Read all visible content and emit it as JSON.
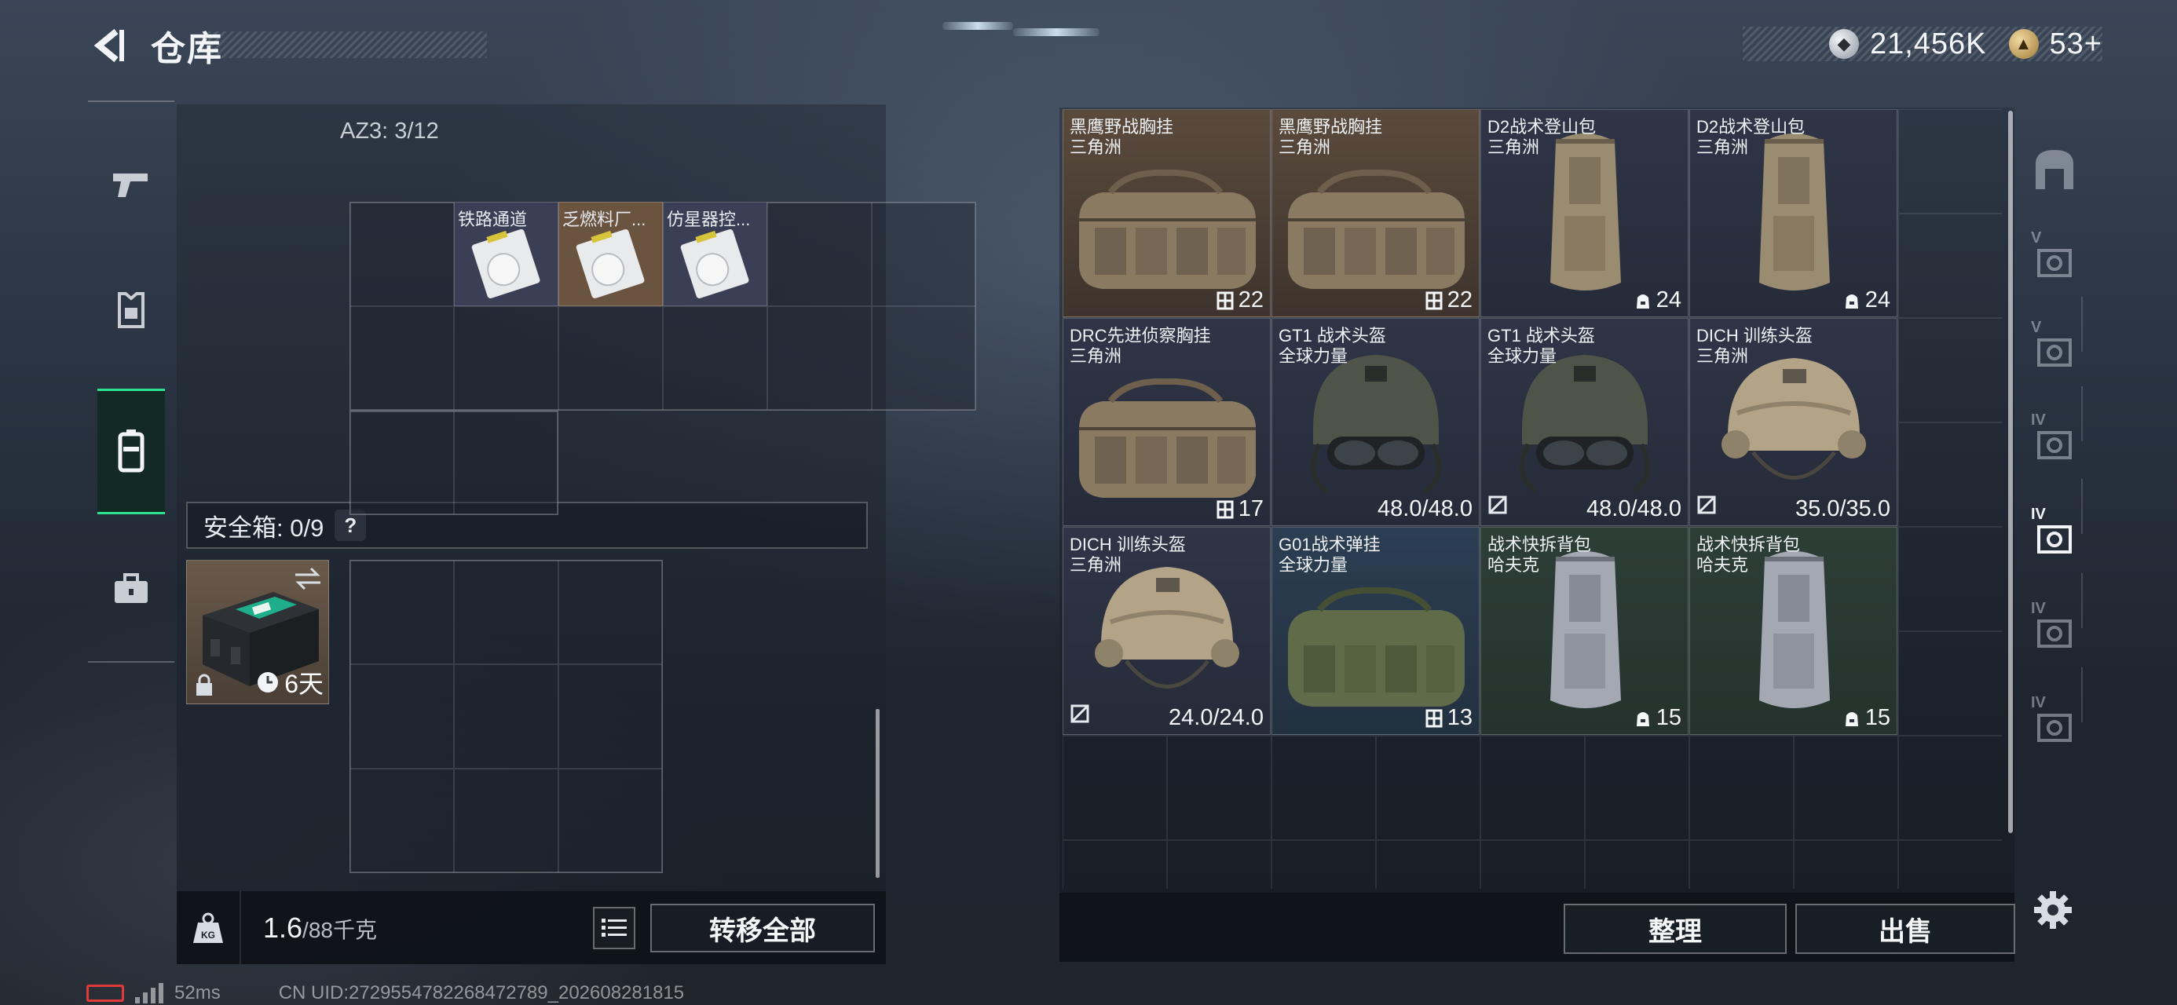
{
  "header": {
    "title": "仓库",
    "currencies": [
      {
        "icon": "silver-coin-icon",
        "value": "21,456K"
      },
      {
        "icon": "gold-coin-icon",
        "value": "53+"
      }
    ]
  },
  "left_rail": {
    "tabs": [
      {
        "name": "weapons",
        "icon": "pistol-icon"
      },
      {
        "name": "equipment",
        "icon": "vest-icon"
      },
      {
        "name": "backpack",
        "icon": "backpack-icon",
        "active": true
      },
      {
        "name": "supplies",
        "icon": "toolbox-icon"
      }
    ]
  },
  "container": {
    "label": "AZ3: 3/12",
    "tickets": [
      {
        "name": "铁路通道"
      },
      {
        "name": "乏燃料厂..."
      },
      {
        "name": "仿星器控..."
      }
    ]
  },
  "safe": {
    "label": "安全箱: 0/9",
    "help": "?",
    "timer": "6天"
  },
  "footer_left": {
    "weight_icon": "kg-weight-icon",
    "weight": "1.6",
    "weight_max": "/88千克",
    "transfer_all": "转移全部"
  },
  "items": [
    {
      "name": "黑鹰野战胸挂",
      "brand": "三角洲",
      "value": "22",
      "value_icon": "capacity-icon",
      "art": "bag",
      "bg": "brown"
    },
    {
      "name": "黑鹰野战胸挂",
      "brand": "三角洲",
      "value": "22",
      "value_icon": "capacity-icon",
      "art": "bag",
      "bg": "brown"
    },
    {
      "name": "D2战术登山包",
      "brand": "三角洲",
      "value": "24",
      "value_icon": "backpack-slots-icon",
      "art": "pack",
      "bg": "navy"
    },
    {
      "name": "D2战术登山包",
      "brand": "三角洲",
      "value": "24",
      "value_icon": "backpack-slots-icon",
      "art": "pack",
      "bg": "navy"
    },
    {
      "name": "DRC先进侦察胸挂",
      "brand": "三角洲",
      "value": "17",
      "value_icon": "capacity-icon",
      "art": "bag",
      "bg": "navy"
    },
    {
      "name": "GT1 战术头盔",
      "brand": "全球力量",
      "value": "48.0/48.0",
      "value_icon": "",
      "art": "helmet-green",
      "bg": "navy"
    },
    {
      "name": "GT1 战术头盔",
      "brand": "全球力量",
      "value": "48.0/48.0",
      "value_icon": "",
      "art": "helmet-green",
      "bg": "navy",
      "broken_icon": true
    },
    {
      "name": "DICH 训练头盔",
      "brand": "三角洲",
      "value": "35.0/35.0",
      "value_icon": "",
      "art": "helmet-tan",
      "bg": "navy",
      "broken_icon": true
    },
    {
      "name": "DICH 训练头盔",
      "brand": "三角洲",
      "value": "24.0/24.0",
      "value_icon": "",
      "art": "helmet-tan",
      "bg": "navy",
      "broken_icon": true
    },
    {
      "name": "G01战术弹挂",
      "brand": "全球力量",
      "value": "13",
      "value_icon": "capacity-icon",
      "art": "bag-green",
      "bg": "blue"
    },
    {
      "name": "战术快拆背包",
      "brand": "哈夫克",
      "value": "15",
      "value_icon": "backpack-slots-icon",
      "art": "pack-grey",
      "bg": "green"
    },
    {
      "name": "战术快拆背包",
      "brand": "哈夫克",
      "value": "15",
      "value_icon": "backpack-slots-icon",
      "art": "pack-grey",
      "bg": "green"
    }
  ],
  "footer_right": {
    "sort": "整理",
    "sell": "出售"
  },
  "right_rail": {
    "items": [
      {
        "name": "all-tier-icon",
        "label": ""
      },
      {
        "name": "tier-5-icon",
        "label": "V"
      },
      {
        "name": "tier-5b-icon",
        "label": "V"
      },
      {
        "name": "tier-4-icon",
        "label": "IV"
      },
      {
        "name": "tier-4-active-icon",
        "label": "IV"
      },
      {
        "name": "tier-4b-icon",
        "label": "IV"
      },
      {
        "name": "tier-4c-icon",
        "label": "IV"
      }
    ]
  },
  "status": {
    "ping": "52ms",
    "uid": "CN UID:2729554782268472789_202608281815"
  }
}
